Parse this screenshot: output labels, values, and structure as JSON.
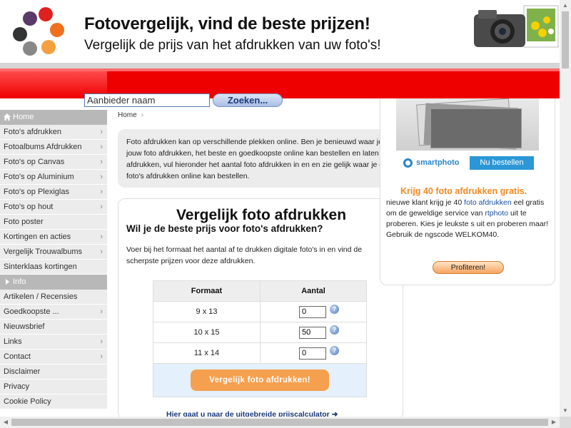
{
  "header": {
    "title": "Fotovergelijk, vind de beste prijzen!",
    "subtitle": "Vergelijk de prijs van het afdrukken van uw foto's!",
    "logo_colors": [
      "#5a3a6a",
      "#e02020",
      "#333333",
      "#f07020",
      "#888888",
      "#f5a040"
    ],
    "accent": "#ee0000"
  },
  "search": {
    "value": "Aanbieder naam",
    "button_label": "Zoeken..."
  },
  "sidebar": {
    "home_label": "Home",
    "items": [
      {
        "label": "Foto's afdrukken"
      },
      {
        "label": "Fotoalbums Afdrukken"
      },
      {
        "label": "Foto's op Canvas"
      },
      {
        "label": "Foto's op Aluminium"
      },
      {
        "label": "Foto's op Plexiglas"
      },
      {
        "label": "Foto's op hout"
      },
      {
        "label": "Foto poster"
      },
      {
        "label": "Kortingen en acties"
      },
      {
        "label": "Vergelijk Trouwalbums"
      },
      {
        "label": "Sinterklaas kortingen"
      }
    ],
    "info_label": "Info",
    "info_items": [
      {
        "label": "Artikelen / Recensies"
      },
      {
        "label": "Goedkoopste ..."
      },
      {
        "label": "Nieuwsbrief"
      },
      {
        "label": "Links"
      },
      {
        "label": "Contact"
      },
      {
        "label": "Disclaimer"
      },
      {
        "label": "Privacy"
      },
      {
        "label": "Cookie Policy"
      }
    ],
    "chevron": "›"
  },
  "breadcrumb": {
    "home": "Home",
    "sep": "›"
  },
  "intro": {
    "text": "Foto afdrukken kan op verschillende plekken online. Ben je benieuwd waar je jouw foto afdrukken, het beste en goedkoopste online kan bestellen en laten afdrukken, vul hieronder het aantal foto afdrukken in en en zie gelijk waar je de foto's afdrukken online kan bestellen."
  },
  "compare": {
    "title": "Vergelijk foto afdrukken",
    "question": "Wil je de beste prijs voor foto's afdrukken?",
    "description": "Voer bij het formaat het aantal af te drukken digitale foto's in en vind de scherpste prijzen voor deze afdrukken.",
    "col_format": "Formaat",
    "col_amount": "Aantal",
    "rows": [
      {
        "format": "9 x 13",
        "amount": "0"
      },
      {
        "format": "10 x 15",
        "amount": "50"
      },
      {
        "format": "11 x 14",
        "amount": "0"
      }
    ],
    "help": "?",
    "button_label": "Vergelijk foto afdrukken!",
    "calculator_link": "Hier gaat u naar de uitgebreide prijscalculator ➜"
  },
  "promo": {
    "brand": "smartphoto",
    "order_label": "Nu bestellen",
    "title": "Krijg 40 foto afdrukken gratis.",
    "text_1": "nieuwe klant krijg je 40 ",
    "text_link_1": "foto afdrukken",
    "text_2": " eel gratis om de geweldige service van ",
    "text_link_2": "rtphoto",
    "text_3": " uit te proberen. Kies je leukste s uit en proberen maar! Gebruik de ngscode WELKOM40.",
    "button_label": "Profiteren!"
  },
  "scroll": {
    "up": "▲",
    "down": "▼",
    "left": "◀",
    "right": "▶"
  }
}
